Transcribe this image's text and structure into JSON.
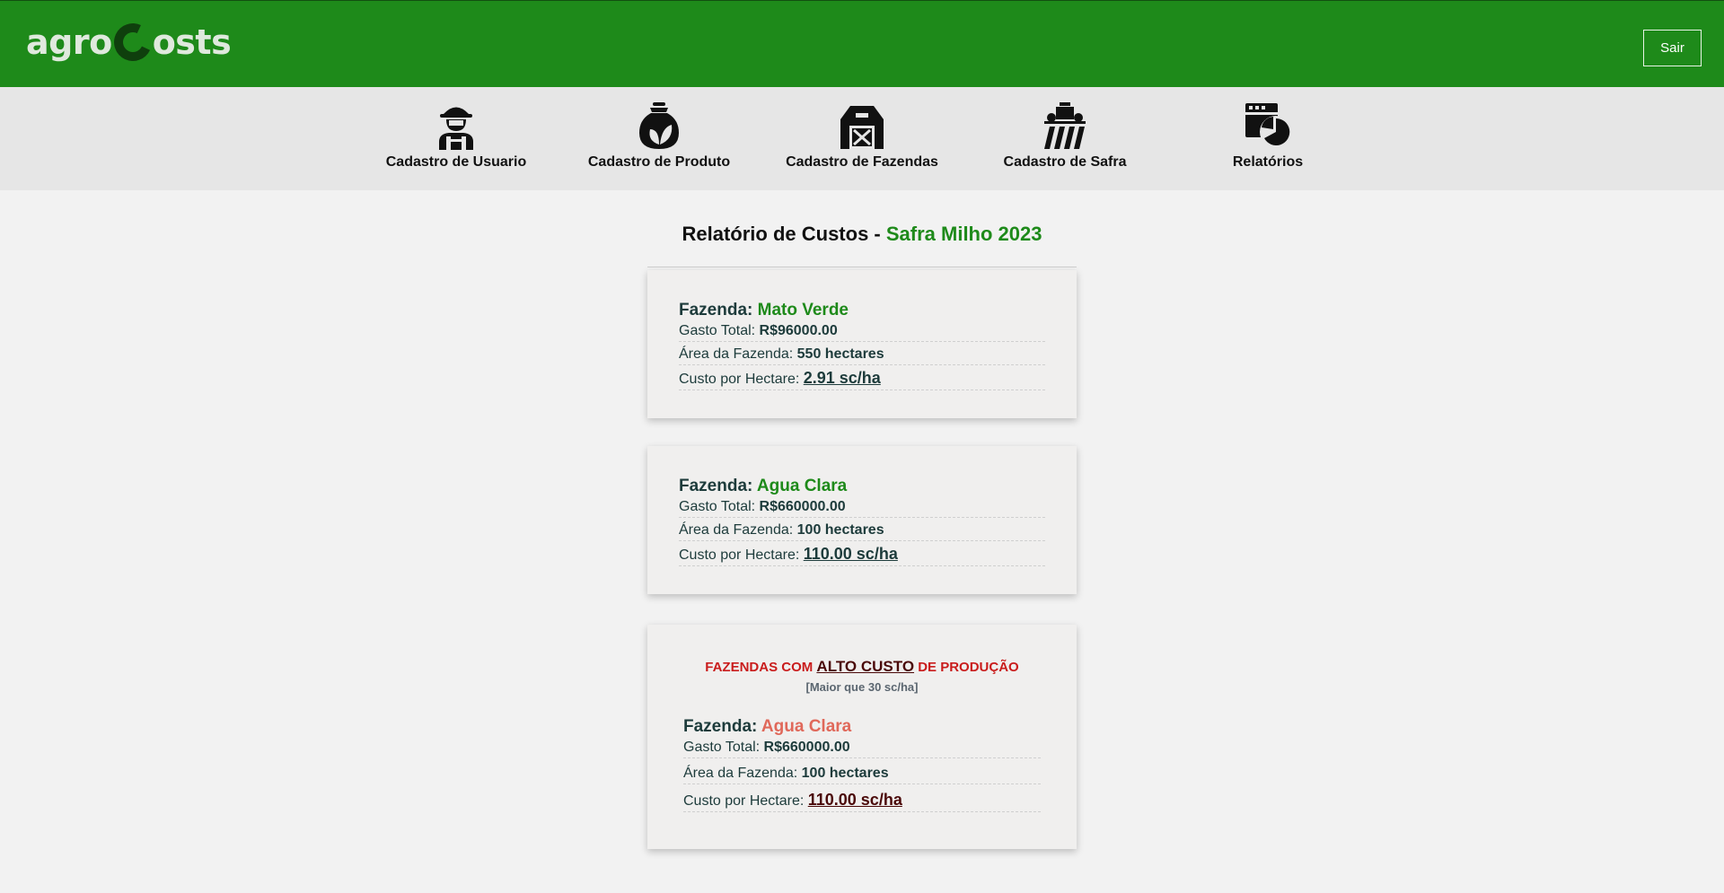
{
  "app": {
    "logo_part1": "agro",
    "logo_part2": "osts",
    "logout_label": "Sair"
  },
  "nav": {
    "items": [
      {
        "label": "Cadastro de Usuario",
        "icon": "farmer-icon"
      },
      {
        "label": "Cadastro de Produto",
        "icon": "fertilizer-bag-icon"
      },
      {
        "label": "Cadastro de Fazendas",
        "icon": "barn-icon"
      },
      {
        "label": "Cadastro de Safra",
        "icon": "tractor-field-icon"
      },
      {
        "label": "Relatórios",
        "icon": "report-chart-icon"
      }
    ]
  },
  "report": {
    "title_prefix": "Relatório de Custos - ",
    "title_highlight": "Safra Milho 2023"
  },
  "labels": {
    "fazenda": "Fazenda: ",
    "gasto_total": "Gasto Total: ",
    "area": "Área da Fazenda: ",
    "custo_hectare": "Custo por Hectare: "
  },
  "farms": [
    {
      "name": "Mato Verde",
      "gasto_total": "R$96000.00",
      "area": "550 hectares",
      "custo_hectare": "2.91 sc/ha"
    },
    {
      "name": "Agua Clara",
      "gasto_total": "R$660000.00",
      "area": "100 hectares",
      "custo_hectare": "110.00 sc/ha"
    }
  ],
  "alert": {
    "title_before": "FAZENDAS COM ",
    "title_emph": "ALTO CUSTO",
    "title_after": " DE PRODUÇÃO",
    "subtitle": "[Maior que 30 sc/ha]",
    "farms": [
      {
        "name": "Agua Clara",
        "gasto_total": "R$660000.00",
        "area": "100 hectares",
        "custo_hectare": "110.00 sc/ha"
      }
    ]
  },
  "colors": {
    "header_green": "#1e8a1a",
    "accent_red": "#c91c1c",
    "alert_farm_name": "#e0685a"
  }
}
